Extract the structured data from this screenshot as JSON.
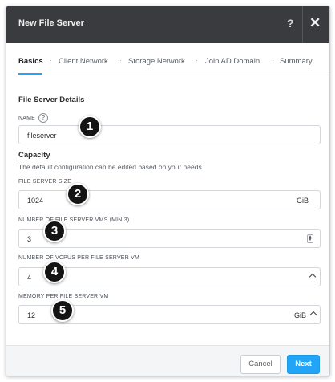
{
  "dialog": {
    "title": "New File Server",
    "help_label": "?",
    "close_label": "✕"
  },
  "tabs": [
    {
      "label": "Basics",
      "active": true
    },
    {
      "label": "Client Network",
      "active": false
    },
    {
      "label": "Storage Network",
      "active": false
    },
    {
      "label": "Join AD Domain",
      "active": false
    },
    {
      "label": "Summary",
      "active": false
    }
  ],
  "tab_separator": "·",
  "details": {
    "title": "File Server Details",
    "name_label": "NAME",
    "name_help": "?",
    "name_value": "fileserver"
  },
  "capacity": {
    "title": "Capacity",
    "description": "The default configuration can be edited based on your needs.",
    "size_label": "FILE SERVER SIZE",
    "size_value": "1024",
    "size_unit": "GiB",
    "vms_label": "NUMBER OF FILE SERVER VMS (MIN 3)",
    "vms_value": "3",
    "vcpus_label": "NUMBER OF VCPUS PER FILE SERVER VM",
    "vcpus_value": "4",
    "memory_label": "MEMORY PER FILE SERVER VM",
    "memory_value": "12",
    "memory_unit": "GiB"
  },
  "callouts": [
    "1",
    "2",
    "3",
    "4",
    "5"
  ],
  "footer": {
    "cancel_label": "Cancel",
    "next_label": "Next"
  },
  "colors": {
    "titlebar": "#3a3b3e",
    "accent": "#22a5f7",
    "callout": "#141414"
  }
}
